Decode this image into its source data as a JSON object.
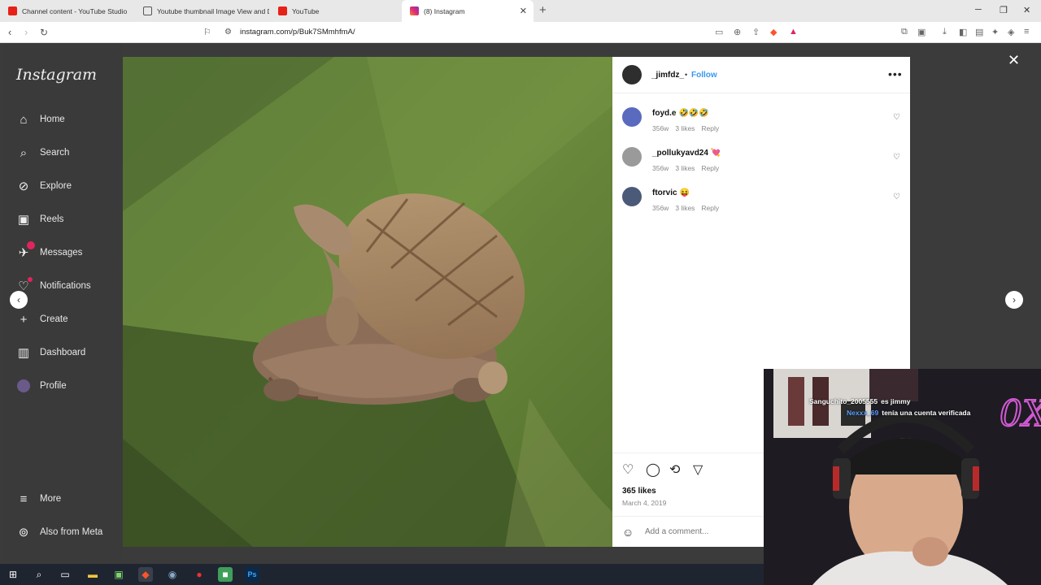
{
  "browser": {
    "tabs": [
      {
        "title": "Channel content - YouTube Studio",
        "icon": "youtube-icon"
      },
      {
        "title": "Youtube thumbnail Image View and D",
        "icon": "page-icon"
      },
      {
        "title": "YouTube",
        "icon": "youtube-icon"
      },
      {
        "title": "(8) Instagram",
        "icon": "instagram-icon"
      }
    ],
    "url": "instagram.com/p/Buk7SMmhfmA/"
  },
  "sidebar": {
    "logo": "Instagram",
    "items": [
      {
        "label": "Home",
        "icon": "home-icon"
      },
      {
        "label": "Search",
        "icon": "search-icon"
      },
      {
        "label": "Explore",
        "icon": "compass-icon"
      },
      {
        "label": "Reels",
        "icon": "reels-icon"
      },
      {
        "label": "Messages",
        "icon": "messenger-icon"
      },
      {
        "label": "Notifications",
        "icon": "heart-icon"
      },
      {
        "label": "Create",
        "icon": "plus-icon"
      },
      {
        "label": "Dashboard",
        "icon": "dashboard-icon"
      },
      {
        "label": "Profile",
        "icon": "profile-avatar"
      }
    ],
    "bottom": [
      {
        "label": "More",
        "icon": "menu-icon"
      },
      {
        "label": "Also from Meta",
        "icon": "meta-icon"
      }
    ]
  },
  "post": {
    "author": "_jimfdz_",
    "separator": "•",
    "follow_label": "Follow",
    "comments": [
      {
        "user": "foyd.e",
        "text": "🤣🤣🤣",
        "age": "356w",
        "likes": "3 likes",
        "reply": "Reply"
      },
      {
        "user": "_pollukyavd24",
        "text": "💘",
        "age": "356w",
        "likes": "3 likes",
        "reply": "Reply"
      },
      {
        "user": "ftorvic",
        "text": "😝",
        "age": "356w",
        "likes": "3 likes",
        "reply": "Reply"
      }
    ],
    "likes": "365 likes",
    "date": "March 4, 2019",
    "comment_placeholder": "Add a comment..."
  },
  "stream": {
    "chat": [
      {
        "user": "Sanguchito_2005555",
        "text": "es jimmy"
      },
      {
        "user": "Nexxx_69",
        "text": "tenía una cuenta verificada"
      }
    ]
  },
  "colors": {
    "accent": "#3897f0",
    "badge": "#e0245e",
    "overlay": "#3b3b3b"
  }
}
